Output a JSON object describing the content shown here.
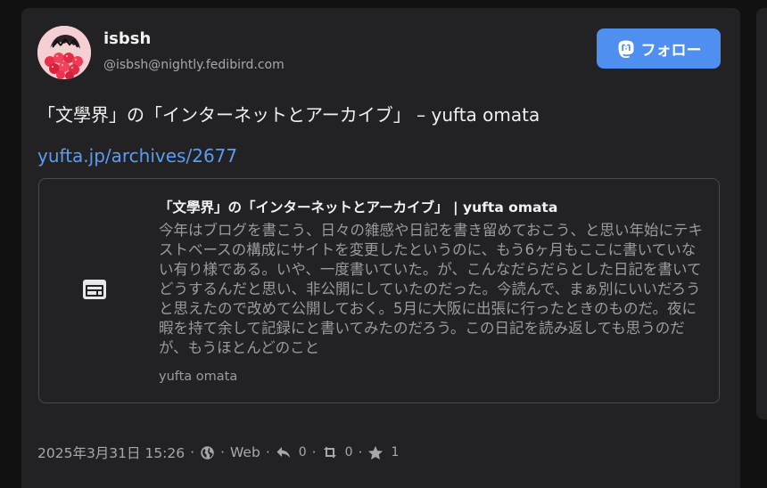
{
  "account": {
    "display_name": "isbsh",
    "handle": "@isbsh@nightly.fedibird.com"
  },
  "follow_button": {
    "label": "フォロー",
    "icon": "mastodon-icon",
    "color": "#4e8ff0"
  },
  "post": {
    "text": "「文學界」の「インターネットとアーカイブ」 – yufta omata",
    "link": "yufta.jp/archives/2677",
    "link_color": "#5b9cf2"
  },
  "link_card": {
    "icon": "web-page-icon",
    "title": "「文學界」の「インターネットとアーカイブ」 | yufta omata",
    "description": "今年はブログを書こう、日々の雑感や日記を書き留めておこう、と思い年始にテキストベースの構成にサイトを変更したというのに、もう6ヶ月もここに書いていない有り様である。いや、一度書いていた。が、こんなだらだらとした日記を書いてどうするんだと思い、非公開にしていたのだった。今読んで、まぁ別にいいだろうと思えたので改めて公開しておく。5月に大阪に出張に行ったときのものだ。夜に暇を持て余して記録にと書いてみたのだろう。この日記を読み返しても思うのだが、もうほとんどのこと",
    "provider": "yufta omata"
  },
  "meta": {
    "timestamp": "2025年3月31日 15:26",
    "separator": "·",
    "visibility_icon": "globe-icon",
    "application": "Web",
    "reply_count": "0",
    "boost_count": "0",
    "favourite_count": "1"
  },
  "colors": {
    "background": "#111112",
    "card": "#222224",
    "muted_text": "#a7a7ad"
  }
}
